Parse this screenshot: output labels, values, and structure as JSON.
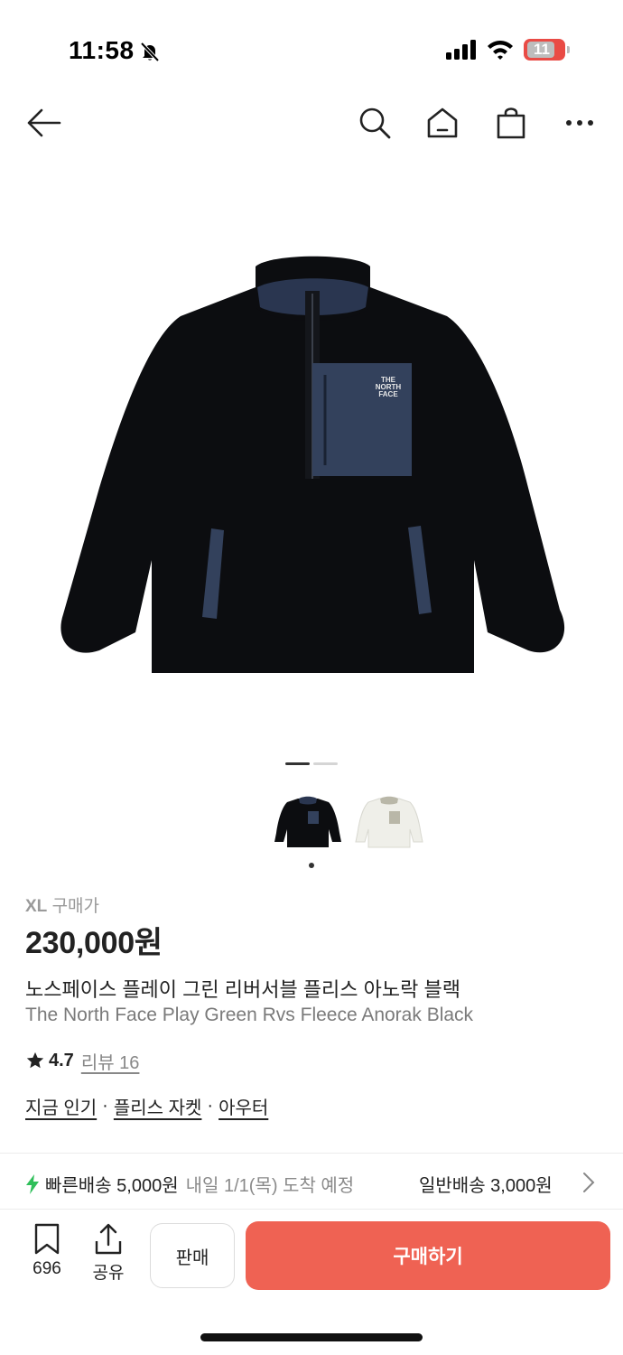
{
  "status_bar": {
    "time": "11:58",
    "battery": "11",
    "icons": [
      "bell-slash-icon",
      "signal-icon",
      "wifi-icon",
      "battery-icon"
    ]
  },
  "nav": {
    "icons": [
      "back-arrow-icon",
      "search-icon",
      "home-icon",
      "shopping-bag-icon",
      "more-icon"
    ]
  },
  "product": {
    "size_label": "XL",
    "price_type": "구매가",
    "price": "230,000원",
    "name_ko": "노스페이스 플레이 그린 리버서블 플리스 아노락 블랙",
    "name_en": "The North Face Play Green Rvs Fleece Anorak Black",
    "rating": "4.7",
    "review_label": "리뷰 16",
    "categories": [
      "지금 인기",
      "플리스 자켓",
      "아우터"
    ],
    "category_separator": "·",
    "image_logo_text": "THE NORTH FACE",
    "gallery": {
      "total": 2,
      "current": 1
    },
    "thumbnails": [
      "black",
      "cream"
    ]
  },
  "shipping": {
    "fast_label": "빠른배송 5,000원",
    "fast_date": "내일 1/1(목) 도착 예정",
    "normal_label": "일반배송 3,000원",
    "accent_color": "#2fbf5a"
  },
  "bottom_bar": {
    "wishlist_count": "696",
    "share_label": "공유",
    "sell_label": "판매",
    "buy_label": "구매하기",
    "buy_color": "#ef6253"
  }
}
